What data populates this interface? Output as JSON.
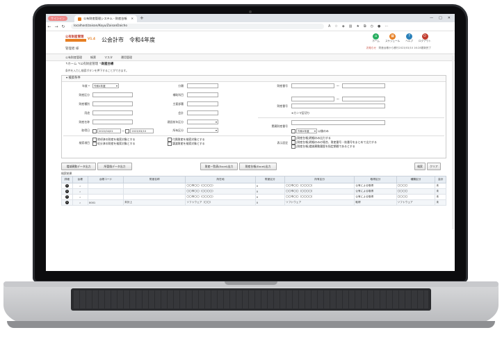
{
  "browser": {
    "profile_label": "サインイン",
    "tab_title": "公有財産管理システム - 財産台帳",
    "url": "localhost/zaisan/Koyu/ZaisanDaicho",
    "icons": [
      "refresh-icon",
      "star-icon",
      "extension-icon",
      "favorites-icon",
      "collections-icon",
      "more-icon"
    ]
  },
  "app": {
    "logo_top": "公有財産管理",
    "logo_version": "V1.4",
    "title": "公会計市　令和4年度",
    "user": "管理者 様",
    "header_icons": [
      {
        "label": "ホーム",
        "color": "#27ae60",
        "glyph": "⌂"
      },
      {
        "label": "スケジュール",
        "color": "#e67e22",
        "glyph": "▦"
      },
      {
        "label": "ヘルプ",
        "color": "#2980b9",
        "glyph": "?"
      },
      {
        "label": "ログアウト",
        "color": "#c0392b",
        "glyph": "⏻"
      }
    ],
    "status_red": "お知らせ",
    "status_text": "財産台帳から移行2023/03/10 16:28更新完了"
  },
  "menu": [
    "公有財産管理",
    "帳票",
    "マスタ",
    "運用管理"
  ],
  "breadcrumb": {
    "home": "ホーム",
    "parent": "公有財産管理",
    "current": "財産台帳"
  },
  "hint": "条件を入力し検索ボタンを押下することができます。",
  "panel_title": "検索条件",
  "form": {
    "nendo_label": "年度 *",
    "nendo_value": "令和4年度",
    "daichou_label": "財産区分",
    "shurui_label": "財産種別",
    "youto_label": "用途",
    "zaisanmei_label": "財産名称",
    "kanri_label": "分類",
    "hokan_label": "補助科目",
    "shuyou_label": "主要部署",
    "kaikei_label": "会計",
    "koukou_label": "建設前年区分",
    "kaikeikubun_label": "所有区分",
    "kikan_label": "取得日",
    "date_from": "2022/04/01",
    "date_to": "2023/03/10",
    "zaisan_no_label": "財産番号",
    "zaisan_kbn_label": "財産番号",
    "comma_note": "※カンマ区切り",
    "related_label": "関連財産番号",
    "nendo_sel_label": "令和4年度",
    "nendo_sel_suffix": "以後のみ",
    "kensaku_label": "検索項目",
    "kensaku_opts": [
      "除却済の財産を検索対象とする",
      "処分済の財産を検索対象とする"
    ],
    "kensaku_opts2": [
      "付属財産を検索対象とする",
      "譲渡財産を検索対象とする"
    ],
    "hyouji_label": "表示設定",
    "hyouji_opts": [
      "[財産台帳]明細のみ出力する",
      "[財産台帳]明細のみの場合、財産番号・枝番号をまとめて出力する",
      "[財産台帳]増減異動履歴を指定期間であるとする"
    ]
  },
  "buttons": {
    "btn1": "増減異動データ出力",
    "btn2": "所管換データ出力",
    "btn3": "財産一覧表(Excel)出力",
    "btn4": "財産台帳(Excel)出力",
    "search": "検索",
    "clear": "クリア"
  },
  "result_label": "検索結果",
  "table": {
    "headers": [
      "詳細",
      "台帳",
      "台帳コード",
      "財産名称",
      "所在地",
      "財産区分",
      "所有区分",
      "取得区分",
      "種類区分",
      "会計"
    ],
    "rows": [
      [
        "1",
        "",
        "",
        "",
        "〇〇市〇〇（〇〇〇〇）",
        "0",
        "〇〇市〇〇（〇〇〇〇）",
        "公有による取得",
        "〇〇〇〇",
        "未"
      ],
      [
        "1",
        "",
        "",
        "",
        "〇〇市〇〇（〇〇〇〇）",
        "0",
        "〇〇市〇〇（〇〇〇〇）",
        "公有による取得",
        "〇〇〇〇",
        "未"
      ],
      [
        "1",
        "",
        "",
        "",
        "〇〇市〇〇（〇〇〇〇）",
        "0",
        "〇〇市〇〇（〇〇〇〇）",
        "公有による取得",
        "〇〇〇〇",
        "未"
      ],
      [
        "1",
        "",
        "0001",
        "未計上",
        "ソフトウェア（〇〇）",
        "0",
        "ソフトウェア",
        "取得",
        "ソフトウェア",
        "未"
      ]
    ]
  }
}
